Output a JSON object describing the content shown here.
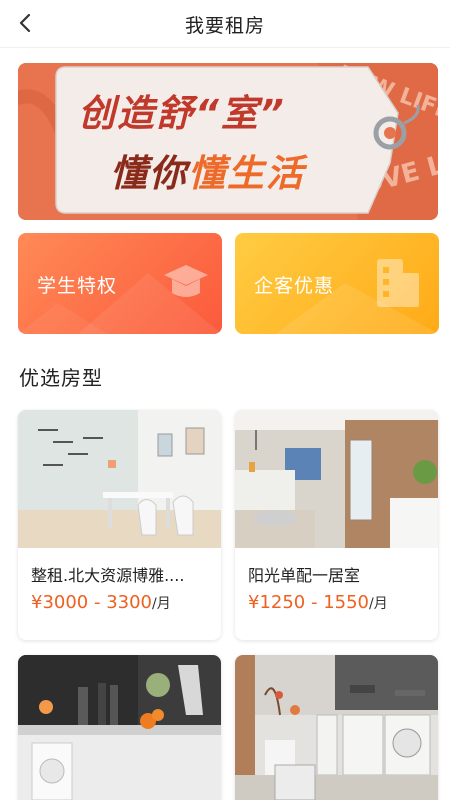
{
  "header": {
    "title": "我要租房"
  },
  "banner": {
    "line1": "创造舒“室”",
    "line2_a": "懂你",
    "line2_b": "懂生活",
    "deco_text": "NEW LIFE",
    "deco_text2": "LOVE LO"
  },
  "promos": [
    {
      "label": "学生特权",
      "icon": "graduation-cap-icon"
    },
    {
      "label": "企客优惠",
      "icon": "building-icon"
    }
  ],
  "section": {
    "title": "优选房型"
  },
  "listings": [
    {
      "name": "整租.北大资源博雅....",
      "price": "¥3000 - 3300",
      "unit": "/月"
    },
    {
      "name": "阳光单配一居室",
      "price": "¥1250 - 1550",
      "unit": "/月"
    },
    {
      "name": "",
      "price": "",
      "unit": ""
    },
    {
      "name": "",
      "price": "",
      "unit": ""
    }
  ],
  "colors": {
    "accent_price": "#f0601f",
    "student_card": "#fb6a44",
    "corp_card": "#ffb52a",
    "banner_bg": "#e8744f"
  }
}
